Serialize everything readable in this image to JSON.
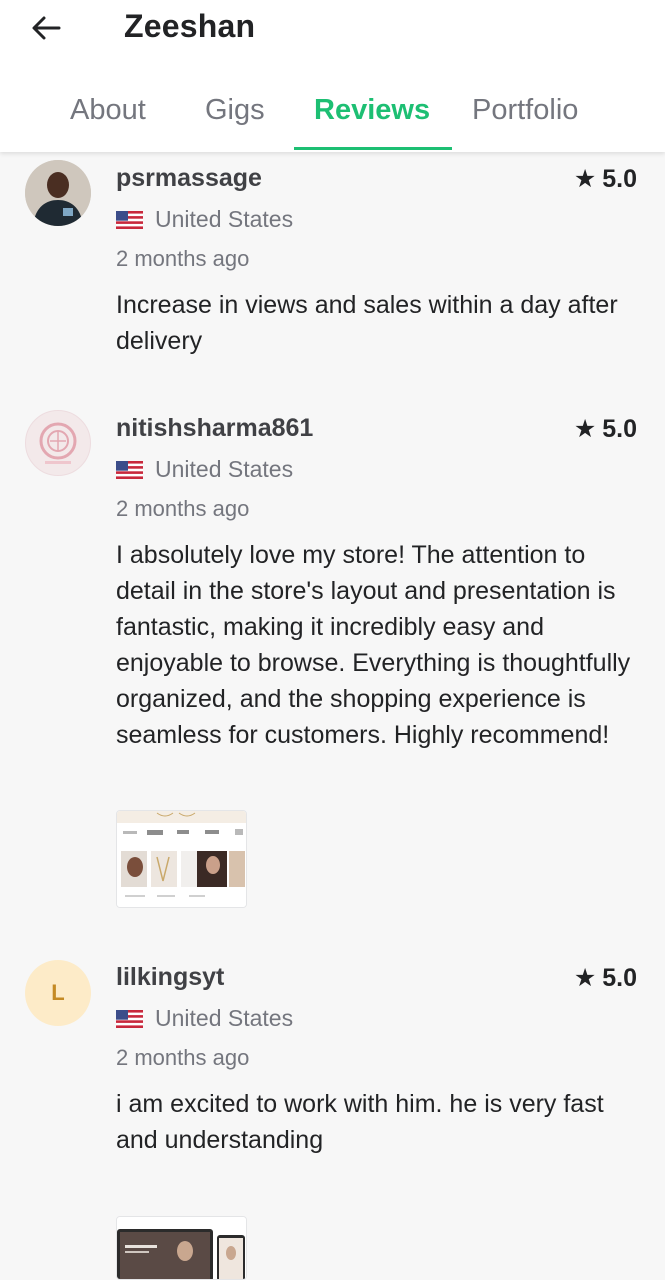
{
  "header": {
    "title": "Zeeshan"
  },
  "tabs": [
    {
      "label": "About"
    },
    {
      "label": "Gigs"
    },
    {
      "label": "Reviews"
    },
    {
      "label": "Portfolio"
    }
  ],
  "active_tab": "Reviews",
  "accent_color": "#1dbf73",
  "reviews": [
    {
      "username": "psrmassage",
      "rating": "5.0",
      "country": "United States",
      "time": "2 months ago",
      "text": "Increase in views and sales within a day after delivery",
      "avatar_type": "photo"
    },
    {
      "username": "nitishsharma861",
      "rating": "5.0",
      "country": "United States",
      "time": "2 months ago",
      "text": "I absolutely love my store! The attention to detail in the store's layout and presentation is fantastic, making it incredibly easy and enjoyable to browse. Everything is thoughtfully organized, and the shopping experience is seamless for customers. Highly recommend!",
      "avatar_type": "logo",
      "has_attachment": true
    },
    {
      "username": "lilkingsyt",
      "rating": "5.0",
      "country": "United States",
      "time": "2 months ago",
      "text": "i am excited to work with him. he is very fast and understanding",
      "avatar_type": "initial",
      "avatar_initial": "L",
      "has_attachment": true
    }
  ]
}
